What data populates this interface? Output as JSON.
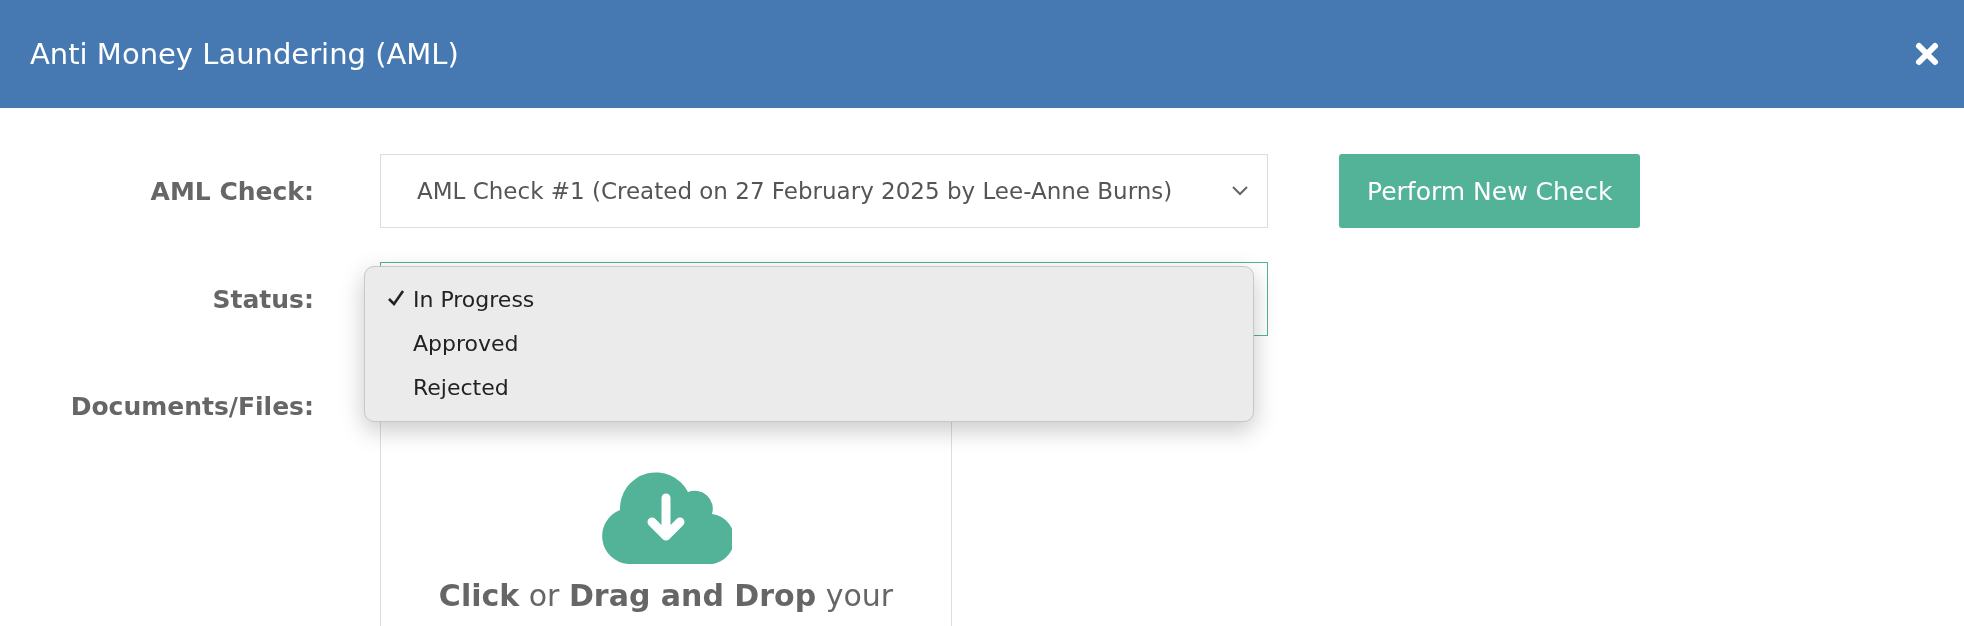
{
  "window": {
    "title": "Anti Money Laundering (AML)"
  },
  "form": {
    "aml_check": {
      "label": "AML Check:",
      "value": "AML Check #1 (Created on 27 February 2025 by Lee-Anne Burns)"
    },
    "perform_button": "Perform New Check",
    "status": {
      "label": "Status:",
      "expanded": true,
      "options": [
        {
          "label": "In Progress",
          "selected": true
        },
        {
          "label": "Approved",
          "selected": false
        },
        {
          "label": "Rejected",
          "selected": false
        }
      ]
    },
    "documents": {
      "label": "Documents/Files:",
      "upload_text": "**Click** or **Drag and Drop** your"
    }
  }
}
